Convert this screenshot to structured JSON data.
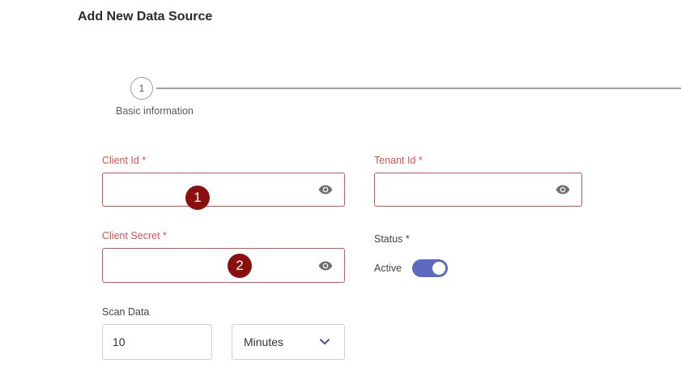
{
  "page": {
    "title": "Add New Data Source"
  },
  "stepper": {
    "steps": [
      {
        "number": "1",
        "label": "Basic information"
      }
    ]
  },
  "form": {
    "client_id": {
      "label": "Client Id *",
      "value": "",
      "icon": "eye-icon"
    },
    "tenant_id": {
      "label": "Tenant Id *",
      "value": "",
      "icon": "eye-icon"
    },
    "client_secret": {
      "label": "Client Secret *",
      "value": "",
      "icon": "eye-icon"
    },
    "status": {
      "label": "Status *",
      "toggle_label": "Active",
      "on": true
    },
    "scan_data": {
      "label": "Scan Data",
      "value": "10",
      "unit": "Minutes",
      "icon": "chevron-down-icon"
    }
  },
  "annotations": {
    "markers": [
      "1",
      "2"
    ]
  },
  "colors": {
    "error": "#d9534f",
    "toggle_on": "#5c6bc0",
    "marker": "#8b0f0f",
    "chevron": "#3f4fa0"
  }
}
